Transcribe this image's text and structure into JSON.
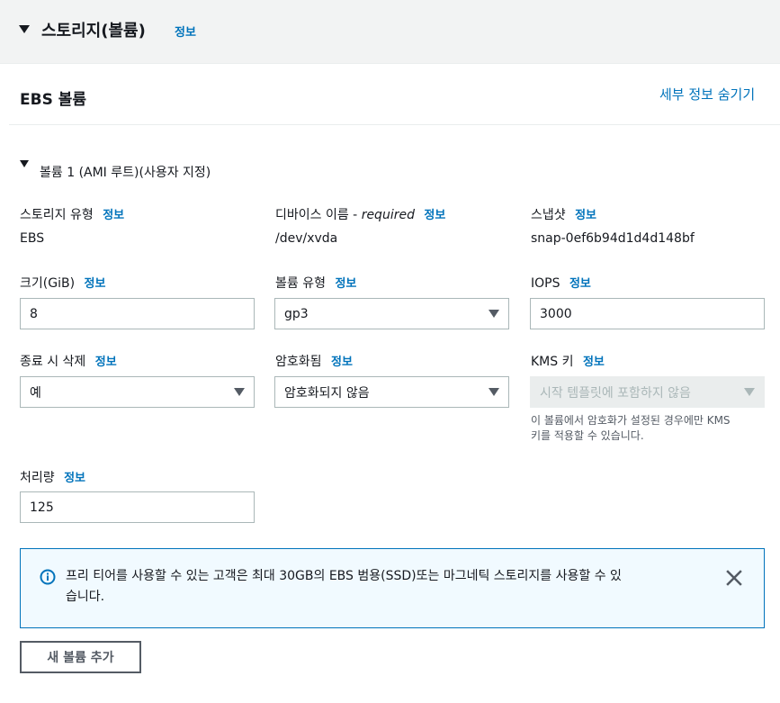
{
  "section": {
    "title": "스토리지(볼륨)",
    "info": "정보"
  },
  "ebs": {
    "title": "EBS 볼륨",
    "hide_details": "세부 정보 숨기기"
  },
  "volume": {
    "title": "볼륨 1 (AMI 루트)(사용자 지정)"
  },
  "fields": {
    "storage_type": {
      "label": "스토리지 유형",
      "info": "정보",
      "value": "EBS"
    },
    "device_name": {
      "label": "디바이스 이름 - ",
      "required": "required",
      "info": "정보",
      "value": "/dev/xvda"
    },
    "snapshot": {
      "label": "스냅샷",
      "info": "정보",
      "value": "snap-0ef6b94d1d4d148bf"
    },
    "size": {
      "label": "크기(GiB)",
      "info": "정보",
      "value": "8"
    },
    "volume_type": {
      "label": "볼륨 유형",
      "info": "정보",
      "value": "gp3"
    },
    "iops": {
      "label": "IOPS",
      "info": "정보",
      "value": "3000"
    },
    "delete_on_termination": {
      "label": "종료 시 삭제",
      "info": "정보",
      "value": "예"
    },
    "encrypted": {
      "label": "암호화됨",
      "info": "정보",
      "value": "암호화되지 않음"
    },
    "kms_key": {
      "label": "KMS 키",
      "info": "정보",
      "value": "시작 템플릿에 포함하지 않음",
      "hint_line1": "이 볼륨에서 암호화가 설정된 경우에만 KMS",
      "hint_line2": "키를 적용할 수 있습니다."
    },
    "throughput": {
      "label": "처리량",
      "info": "정보",
      "value": "125"
    }
  },
  "alert": {
    "line1": "프리 티어를 사용할 수 있는 고객은 최대 30GB의 EBS 범용(SSD)또는 마그네틱 스토리지를 사용할 수 있",
    "line2": "습니다."
  },
  "add_volume": {
    "label": "새 볼륨 추가"
  },
  "colors": {
    "link": "#0073bb",
    "alert_bg": "#f1faff",
    "alert_border": "#0073bb",
    "header_bg": "#f2f3f3"
  },
  "icons": {
    "expand": "caret-down-icon",
    "dropdown": "triangle-down-icon",
    "info": "info-circle-icon",
    "close": "close-x-icon"
  }
}
